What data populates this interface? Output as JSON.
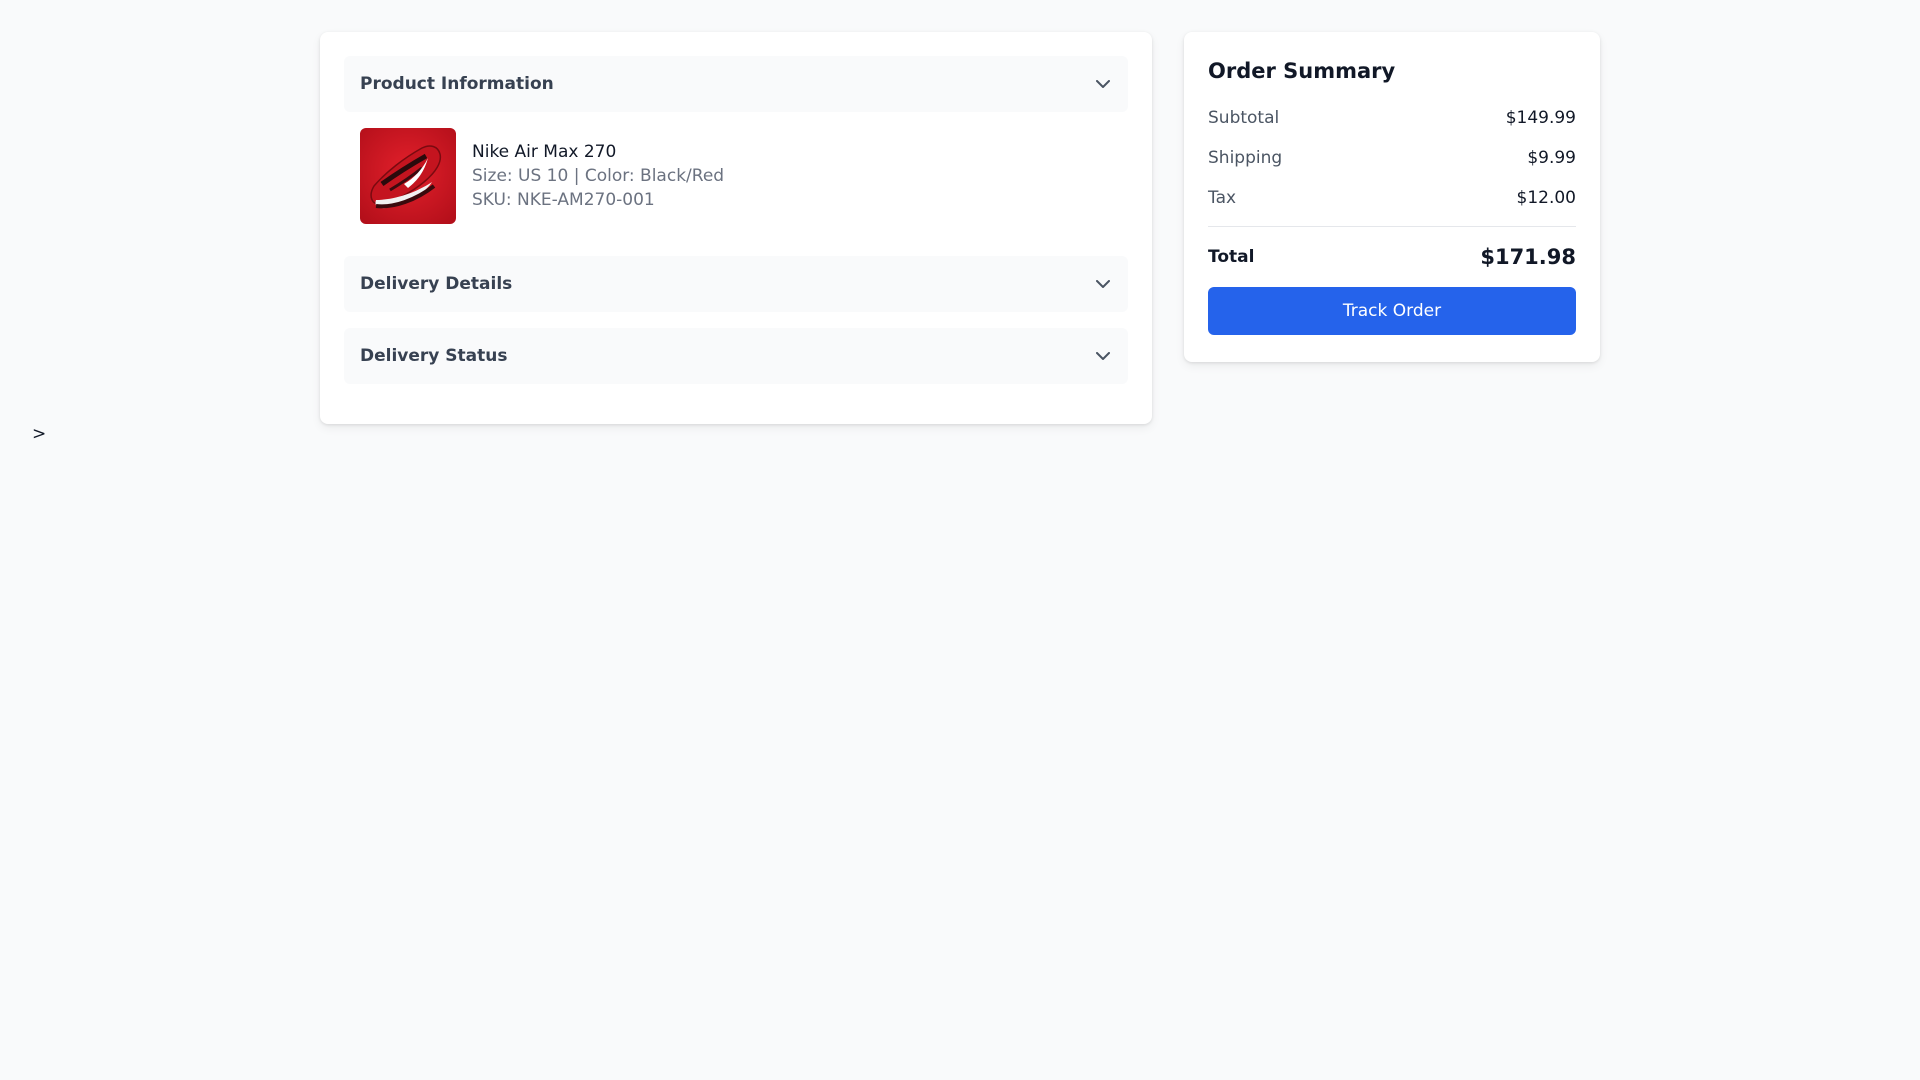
{
  "sections": {
    "product_information": {
      "title": "Product Information"
    },
    "delivery_details": {
      "title": "Delivery Details"
    },
    "delivery_status": {
      "title": "Delivery Status"
    }
  },
  "product": {
    "name": "Nike Air Max 270",
    "size_color": "Size: US 10 | Color: Black/Red",
    "sku": "SKU: NKE-AM270-001"
  },
  "summary": {
    "title": "Order Summary",
    "rows": [
      {
        "label": "Subtotal",
        "value": "$149.99"
      },
      {
        "label": "Shipping",
        "value": "$9.99"
      },
      {
        "label": "Tax",
        "value": "$12.00"
      }
    ],
    "total_label": "Total",
    "total_value": "$171.98",
    "button_label": "Track Order"
  },
  "stray_text": ">",
  "icons": {
    "chevron": "chevron-down-icon"
  },
  "colors": {
    "accent": "#2563eb",
    "background": "#f9fafb",
    "muted_text": "#6b7280"
  }
}
